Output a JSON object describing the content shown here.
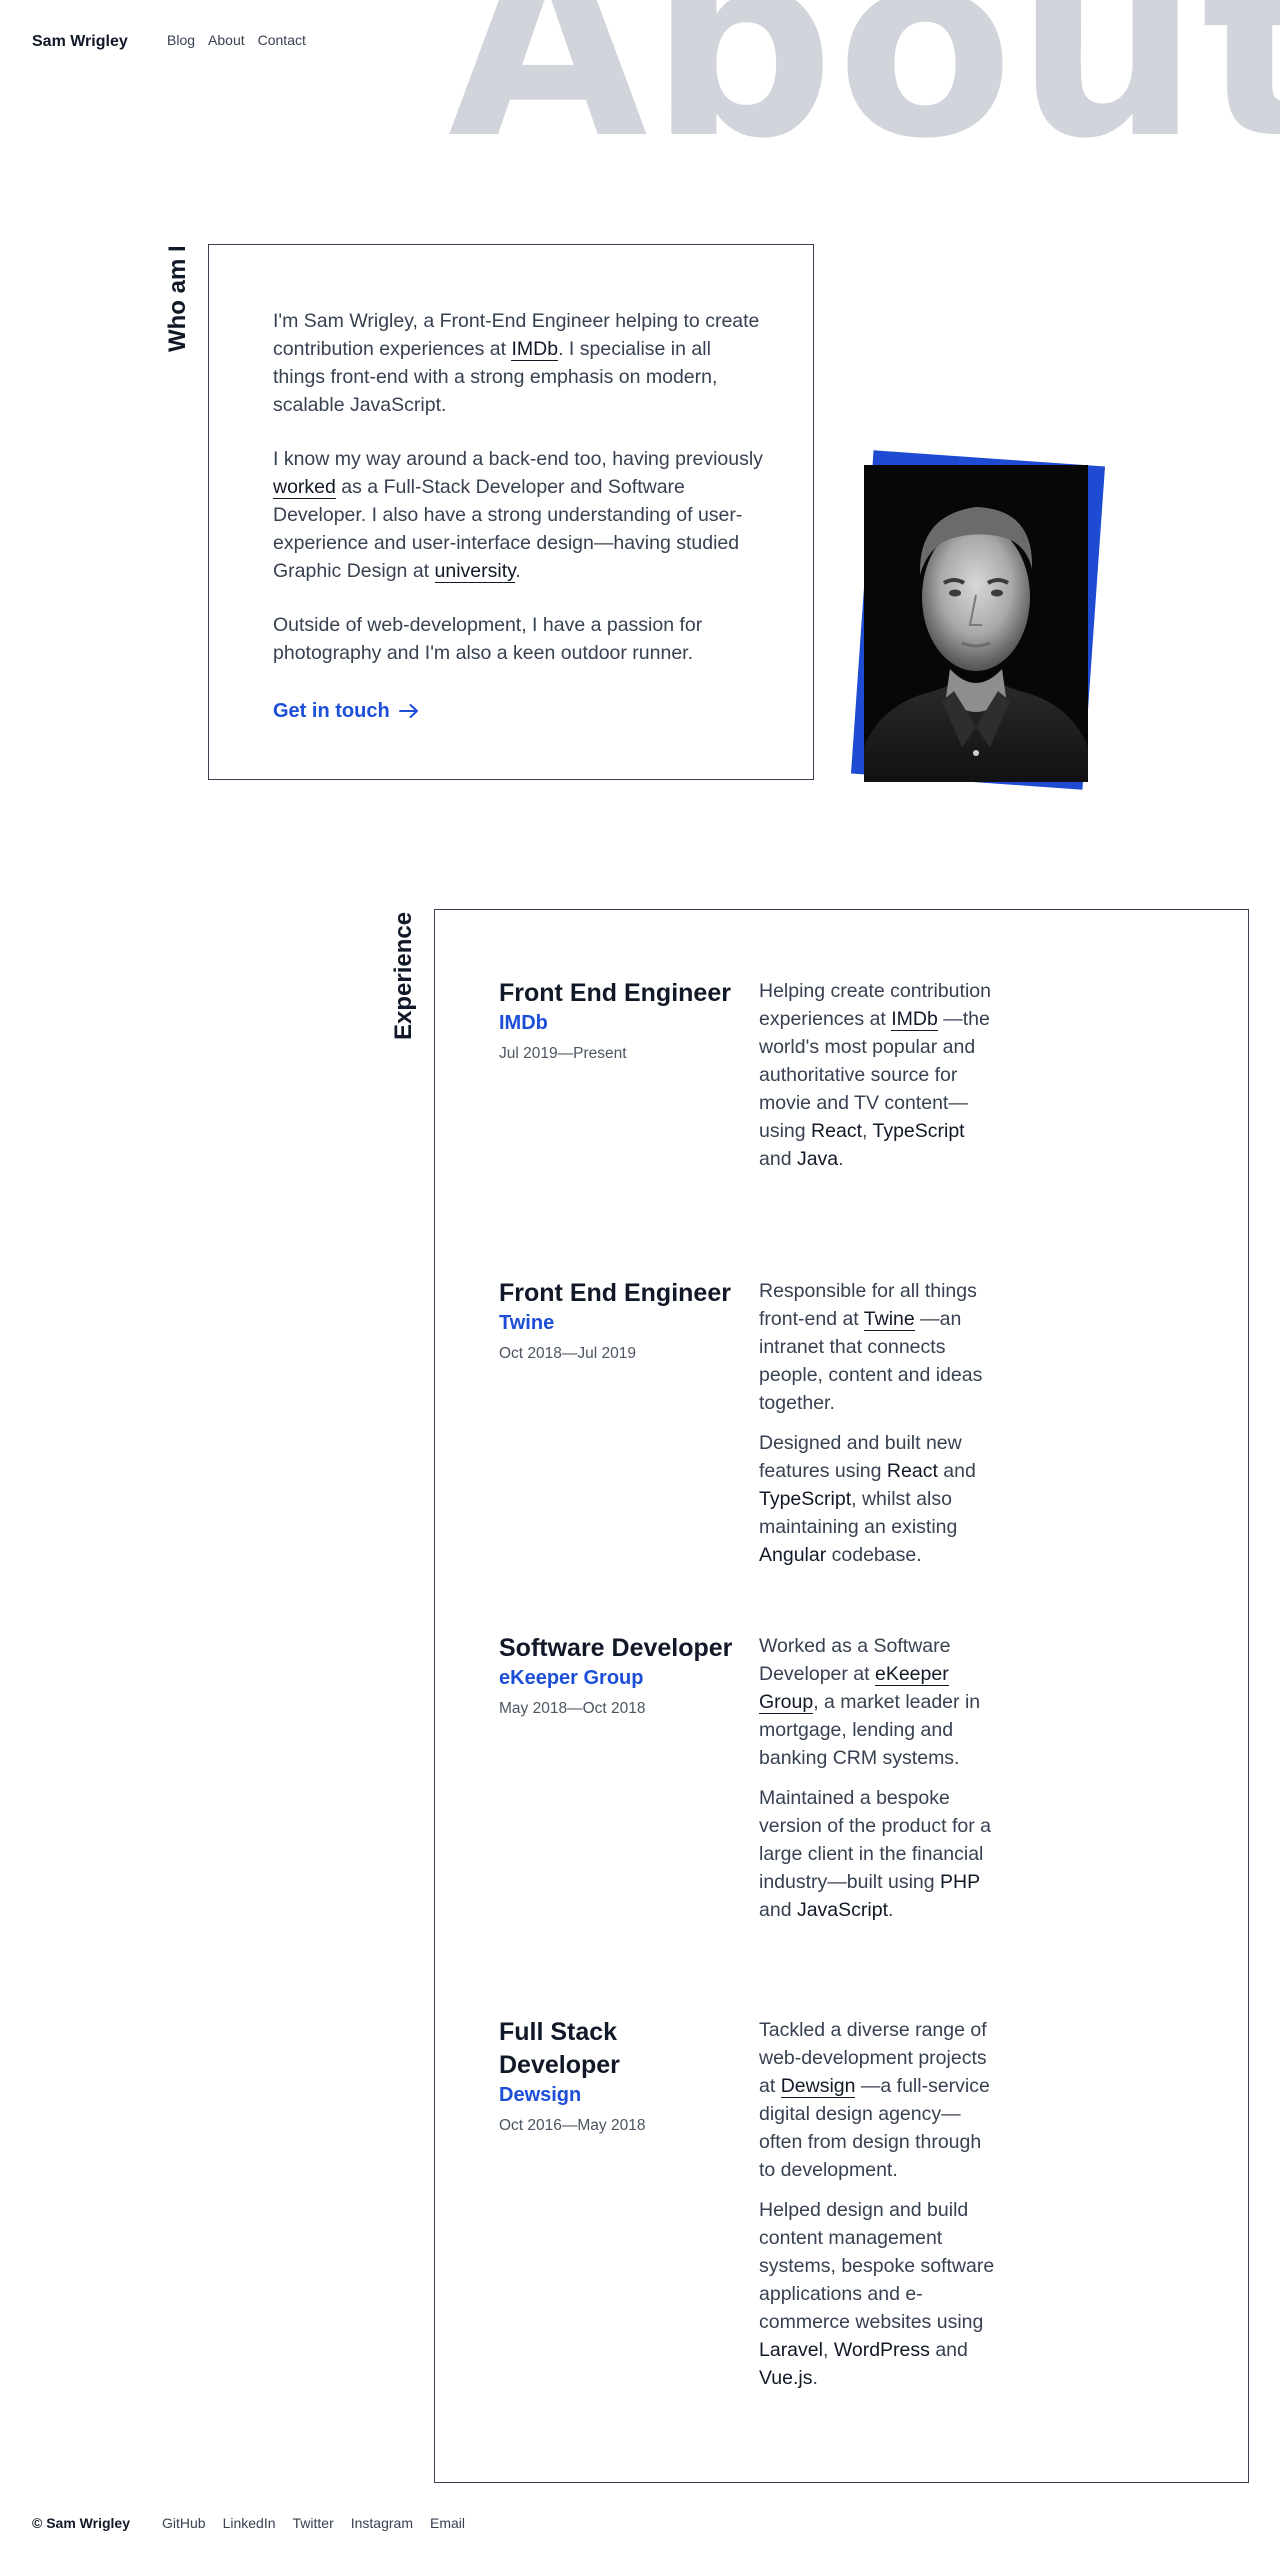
{
  "header": {
    "brand": "Sam Wrigley",
    "nav": [
      "Blog",
      "About",
      "Contact"
    ],
    "hero_word": "About"
  },
  "about": {
    "label": "Who am I",
    "p1": {
      "a": "I'm Sam Wrigley, a Front-End Engineer helping to create contribution experiences at ",
      "link": "IMDb",
      "b": ". I specialise in all things front-end with a strong emphasis on modern, scalable JavaScript."
    },
    "p2": {
      "a": "I know my way around a back-end too, having previously ",
      "link1": "worked",
      "b": " as a Full-Stack Developer and Software Developer. I also have a strong understanding of user-experience and user-interface design—having studied Graphic Design at ",
      "link2": "university",
      "c": "."
    },
    "p3": "Outside of web-development, I have a passion for photography and I'm also a keen outdoor runner.",
    "cta": "Get in touch",
    "photo_accent": "#1e4bd2"
  },
  "experience": {
    "label": "Experience",
    "jobs": [
      {
        "title": "Front End Engineer",
        "company": "IMDb",
        "dates": "Jul 2019—Present",
        "paras": [
          [
            {
              "t": "Helping create contribution experiences at "
            },
            {
              "t": "IMDb",
              "s": "link"
            },
            {
              "t": " —the world's most popular and authoritative source for movie and TV content—using "
            },
            {
              "t": "React",
              "s": "k"
            },
            {
              "t": ", "
            },
            {
              "t": "TypeScript",
              "s": "k"
            },
            {
              "t": " and "
            },
            {
              "t": "Java",
              "s": "k"
            },
            {
              "t": "."
            }
          ]
        ]
      },
      {
        "title": "Front End Engineer",
        "company": "Twine",
        "dates": "Oct 2018—Jul 2019",
        "paras": [
          [
            {
              "t": "Responsible for all things front-end at "
            },
            {
              "t": "Twine",
              "s": "link"
            },
            {
              "t": " —an intranet that connects people, content and ideas together."
            }
          ],
          [
            {
              "t": "Designed and built new features using "
            },
            {
              "t": "React",
              "s": "k"
            },
            {
              "t": " and "
            },
            {
              "t": "TypeScript",
              "s": "k"
            },
            {
              "t": ", whilst also maintaining an existing "
            },
            {
              "t": "Angular",
              "s": "k"
            },
            {
              "t": " codebase."
            }
          ]
        ]
      },
      {
        "title": "Software Developer",
        "company": "eKeeper Group",
        "dates": "May 2018—Oct 2018",
        "paras": [
          [
            {
              "t": "Worked as a Software Developer at "
            },
            {
              "t": "eKeeper Group",
              "s": "link"
            },
            {
              "t": ", a market leader in mortgage, lending and banking CRM systems."
            }
          ],
          [
            {
              "t": "Maintained a bespoke version of the product for a large client in the financial industry—built using "
            },
            {
              "t": "PHP",
              "s": "k"
            },
            {
              "t": " and "
            },
            {
              "t": "JavaScript",
              "s": "k"
            },
            {
              "t": "."
            }
          ]
        ]
      },
      {
        "title": "Full Stack Developer",
        "company": "Dewsign",
        "dates": "Oct 2016—May 2018",
        "paras": [
          [
            {
              "t": "Tackled a diverse range of web-development projects at "
            },
            {
              "t": "Dewsign",
              "s": "link"
            },
            {
              "t": " —a full-service digital design agency—often from design through to development."
            }
          ],
          [
            {
              "t": "Helped design and build content management systems, bespoke software applications and e-commerce websites using "
            },
            {
              "t": "Laravel",
              "s": "k"
            },
            {
              "t": ", "
            },
            {
              "t": "WordPress",
              "s": "k"
            },
            {
              "t": " and "
            },
            {
              "t": "Vue.js",
              "s": "k"
            },
            {
              "t": "."
            }
          ]
        ]
      }
    ]
  },
  "footer": {
    "copyright": "© Sam Wrigley",
    "links": [
      "GitHub",
      "LinkedIn",
      "Twitter",
      "Instagram",
      "Email"
    ]
  }
}
